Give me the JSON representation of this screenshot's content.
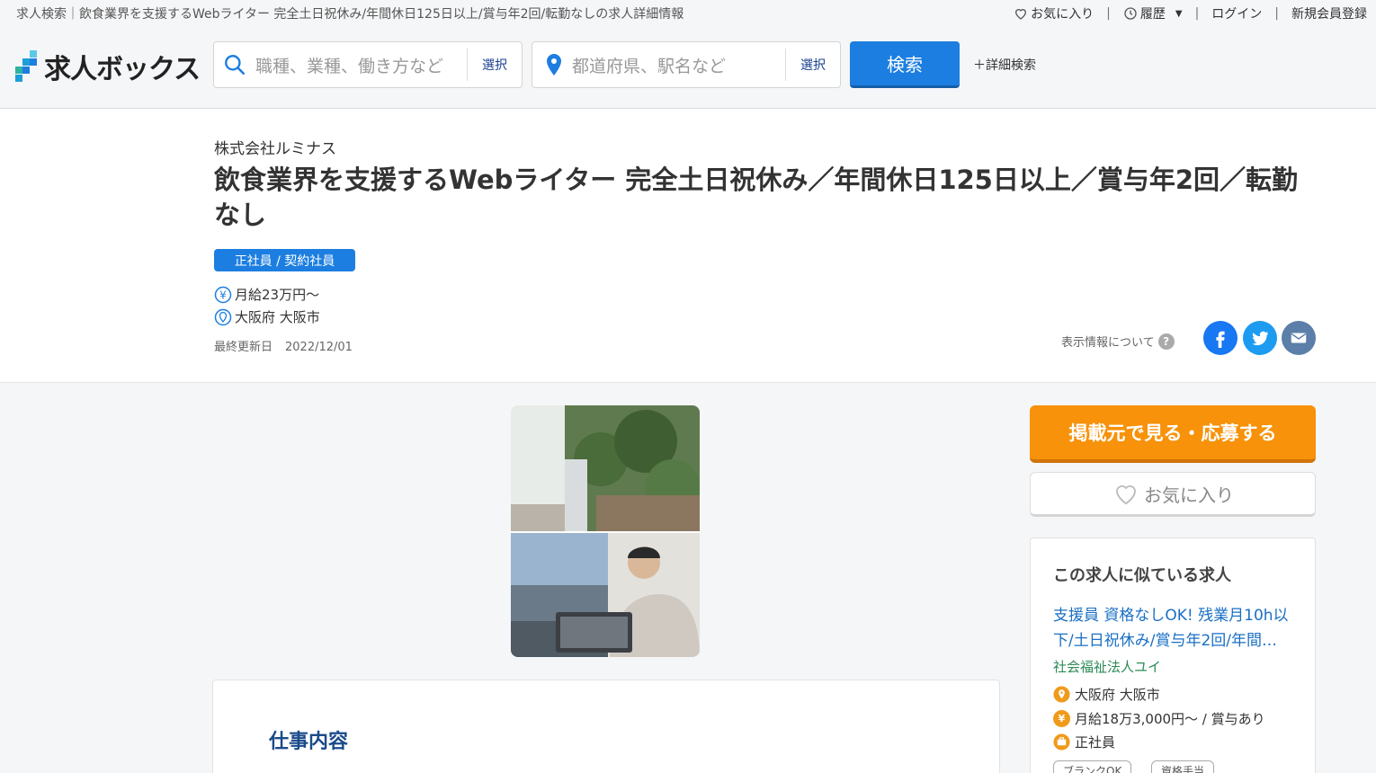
{
  "header": {
    "page_heading": "求人検索｜飲食業界を支援するWebライター 完全土日祝休み/年間休日125日以上/賞与年2回/転勤なしの求人詳細情報",
    "nav": {
      "favorites": "お気に入り",
      "history": "履歴",
      "login": "ログイン",
      "register": "新規会員登録",
      "separator": "|"
    },
    "logo_text": "求人ボックス",
    "search": {
      "keyword_placeholder": "職種、業種、働き方など",
      "keyword_select": "選択",
      "location_placeholder": "都道府県、駅名など",
      "location_select": "選択",
      "search_button": "検索",
      "detail_search": "＋詳細検索"
    }
  },
  "job": {
    "company": "株式会社ルミナス",
    "title": "飲食業界を支援するWebライター 完全土日祝休み／年間休日125日以上／賞与年2回／転勤なし",
    "employment_type": "正社員 / 契約社員",
    "salary": "月給23万円～",
    "location": "大阪府 大阪市",
    "updated_label": "最終更新日",
    "updated_date": "2022/12/01",
    "display_info": "表示情報について"
  },
  "main": {
    "section_title": "仕事内容"
  },
  "sidebar": {
    "apply_button": "掲載元で見る・応募する",
    "favorite_button": "お気に入り",
    "similar_heading": "この求人に似ている求人",
    "similar_job": {
      "title": "支援員 資格なしOK! 残業月10h以下/土日祝休み/賞与年2回/年間…",
      "company": "社会福祉法人ユイ",
      "location": "大阪府 大阪市",
      "salary": "月給18万3,000円～ / 賞与あり",
      "employment": "正社員",
      "tags": [
        "ブランクOK",
        "資格手当"
      ]
    }
  },
  "colors": {
    "accent_blue": "#1c7ee0",
    "apply_orange": "#f7920a",
    "link_blue": "#1a6fc4",
    "company_green": "#2e8b57"
  }
}
